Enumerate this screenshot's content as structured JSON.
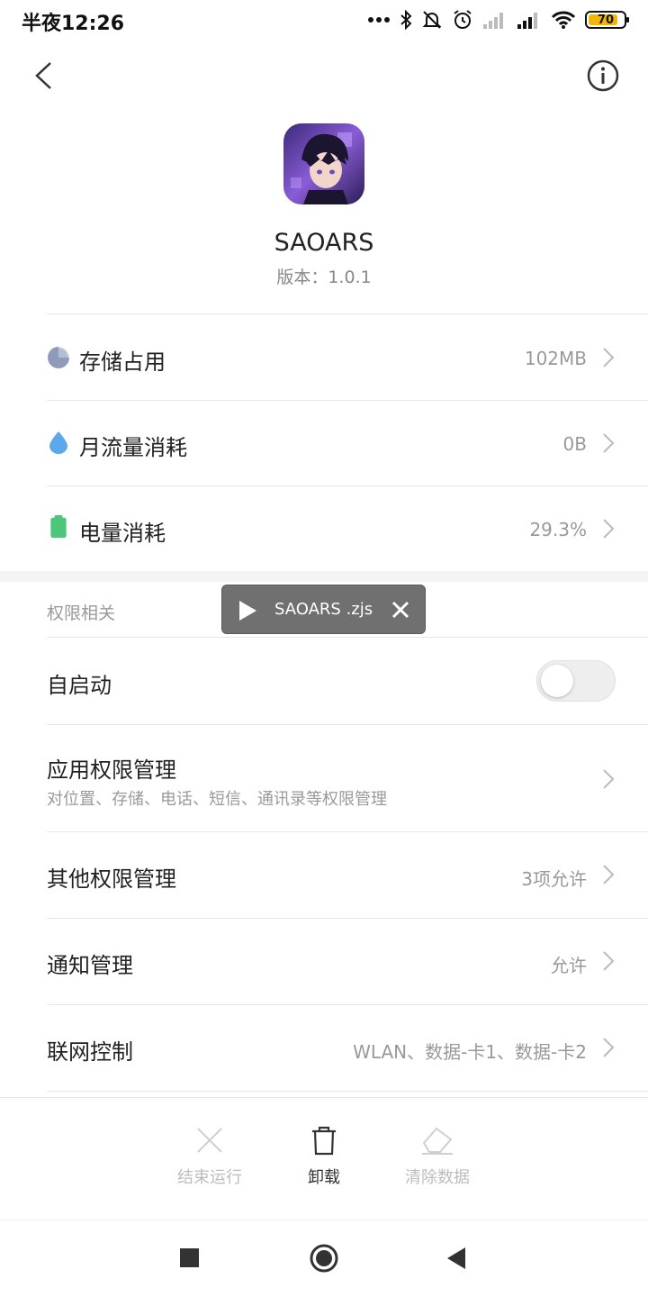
{
  "status_bar": {
    "time": "半夜12:26",
    "battery_level": "70",
    "battery_color": "#f2b705"
  },
  "nav": {
    "back_icon": "chevron-left-icon",
    "info_icon": "info-icon"
  },
  "app": {
    "name": "SAOARS",
    "version": "版本：1.0.1"
  },
  "usage": [
    {
      "label": "存储占用",
      "value": "102MB",
      "icon": "pie-chart-icon",
      "color": "#8f9bb8"
    },
    {
      "label": "月流量消耗",
      "value": "0B",
      "icon": "water-drop-icon",
      "color": "#5aa9ea"
    },
    {
      "label": "电量消耗",
      "value": "29.3%",
      "icon": "battery-icon",
      "color": "#4cc77a"
    }
  ],
  "permissions": {
    "section_title": "权限相关",
    "autostart_label": "自启动",
    "autostart_enabled": false,
    "app_perm_label": "应用权限管理",
    "app_perm_desc": "对位置、存储、电话、短信、通讯录等权限管理",
    "other_perm_label": "其他权限管理",
    "other_perm_value": "3项允许",
    "notify_label": "通知管理",
    "notify_value": "允许",
    "network_label": "联网控制",
    "network_value": "WLAN、数据-卡1、数据-卡2"
  },
  "toast": {
    "text": "SAOARS .zjs"
  },
  "actions": {
    "stop_label": "结束运行",
    "uninstall_label": "卸载",
    "clear_label": "清除数据"
  }
}
